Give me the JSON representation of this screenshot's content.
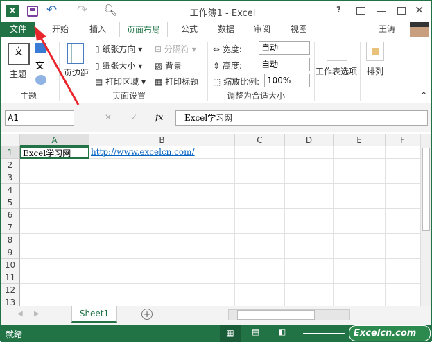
{
  "title": "工作簿1 - Excel",
  "quick_access": {
    "app_icon": "excel-logo",
    "save": "save-icon",
    "undo": "undo-icon",
    "redo": "redo-icon",
    "preview": "print-preview-icon"
  },
  "window_controls": {
    "help": "?"
  },
  "tabs": [
    {
      "label": "文件"
    },
    {
      "label": "开始"
    },
    {
      "label": "插入"
    },
    {
      "label": "页面布局"
    },
    {
      "label": "公式"
    },
    {
      "label": "数据"
    },
    {
      "label": "审阅"
    },
    {
      "label": "视图"
    }
  ],
  "user": "王涛",
  "ribbon": {
    "theme_group": {
      "label": "主题",
      "themes_btn": "主题"
    },
    "page_setup": {
      "label": "页面设置",
      "margins": "页边距",
      "orientation": "纸张方向",
      "size": "纸张大小",
      "print_area": "打印区域",
      "breaks": "分隔符",
      "background": "背景",
      "print_titles": "打印标题"
    },
    "scale_to_fit": {
      "label": "调整为合适大小",
      "width_label": "宽度:",
      "width_value": "自动",
      "height_label": "高度:",
      "height_value": "自动",
      "scale_label": "缩放比例:",
      "scale_value": "100%"
    },
    "sheet_options": "工作表选项",
    "arrange": "排列"
  },
  "formula_bar": {
    "name_box": "A1",
    "fx": "fx",
    "content": "Excel学习网"
  },
  "columns": [
    "A",
    "B",
    "C",
    "D",
    "E",
    "F"
  ],
  "rows": [
    "1",
    "2",
    "3",
    "4",
    "5",
    "6",
    "7",
    "8",
    "9",
    "10",
    "11",
    "12",
    "13"
  ],
  "cells": {
    "A1": "Excel学习网",
    "B1": "http://www.excelcn.com/"
  },
  "sheet_tab": "Sheet1",
  "status": {
    "text": "就绪",
    "watermark": "Excelcn.com"
  },
  "colors": {
    "accent": "#217346",
    "arrow": "#e8262b",
    "link": "#0563c1"
  }
}
